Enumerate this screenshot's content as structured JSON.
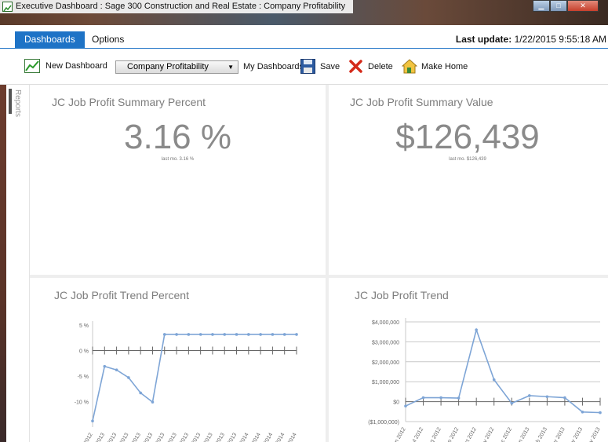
{
  "window": {
    "title": "Executive Dashboard : Sage 300 Construction and Real Estate : Company Profitability"
  },
  "menu": {
    "tab_dashboards": "Dashboards",
    "tab_options": "Options",
    "last_update_label": "Last update:",
    "last_update_value": "1/22/2015 9:55:18 AM"
  },
  "toolbar": {
    "new_dashboard": "New Dashboard",
    "dashboard_select": "Company Profitability",
    "my_dashboards": "My Dashboards",
    "save": "Save",
    "delete": "Delete",
    "make_home": "Make Home"
  },
  "sidebar": {
    "reports_label": "Reports"
  },
  "panels": {
    "percent_summary": {
      "title": "JC Job Profit Summary Percent",
      "value": "3.16 %",
      "sub": "last mo. 3.16 %"
    },
    "value_summary": {
      "title": "JC Job Profit Summary Value",
      "value": "$126,439",
      "sub": "last mo. $126,439"
    },
    "trend_percent": {
      "title": "JC Job Profit Trend Percent"
    },
    "trend_value": {
      "title": "JC Job Profit Trend"
    }
  },
  "colors": {
    "accent": "#1e73c6",
    "series": "#7ea5d6"
  },
  "chart_data": [
    {
      "type": "line",
      "title": "JC Job Profit Trend Percent",
      "ylim": [
        -15,
        5
      ],
      "yticks": [
        "5 %",
        "0 %",
        "-5 %",
        "-10 %"
      ],
      "ytick_values": [
        5,
        0,
        -5,
        -10
      ],
      "x": [
        "Dec 2012",
        "Jan 2013",
        "Feb 2013",
        "Mar 2013",
        "Apr 2013",
        "May 2013",
        "Jun 2013",
        "Jul 2013",
        "Aug 2013",
        "Sep 2013",
        "Oct 2013",
        "Nov 2013",
        "Dec 2013",
        "Jan 2014",
        "Feb 2014",
        "Mar 2014",
        "Apr 2014",
        "May 2014"
      ],
      "series": [
        {
          "values": [
            -13.8,
            -3.1,
            -3.8,
            -5.3,
            -8.3,
            -10.1,
            3.16,
            3.16,
            3.16,
            3.16,
            3.16,
            3.16,
            3.16,
            3.16,
            3.16,
            3.16,
            3.16,
            3.16
          ]
        }
      ]
    },
    {
      "type": "line",
      "title": "JC Job Profit Trend",
      "ylim": [
        -1000000,
        4000000
      ],
      "yticks": [
        "$4,000,000",
        "$3,000,000",
        "$2,000,000",
        "$1,000,000",
        "$0",
        "($1,000,000)"
      ],
      "ytick_values": [
        4000000,
        3000000,
        2000000,
        1000000,
        0,
        -1000000
      ],
      "x": [
        "Jun 2012",
        "Jul 2012",
        "Aug 2012",
        "Sep 2012",
        "Oct 2012",
        "Nov 2012",
        "Dec 2012",
        "Jan 2013",
        "Feb 2013",
        "Mar 2013",
        "Apr 2013",
        "May 2013"
      ],
      "series": [
        {
          "values": [
            -220000,
            200000,
            200000,
            180000,
            3600000,
            1100000,
            -80000,
            300000,
            250000,
            200000,
            -520000,
            -550000
          ]
        }
      ]
    }
  ]
}
